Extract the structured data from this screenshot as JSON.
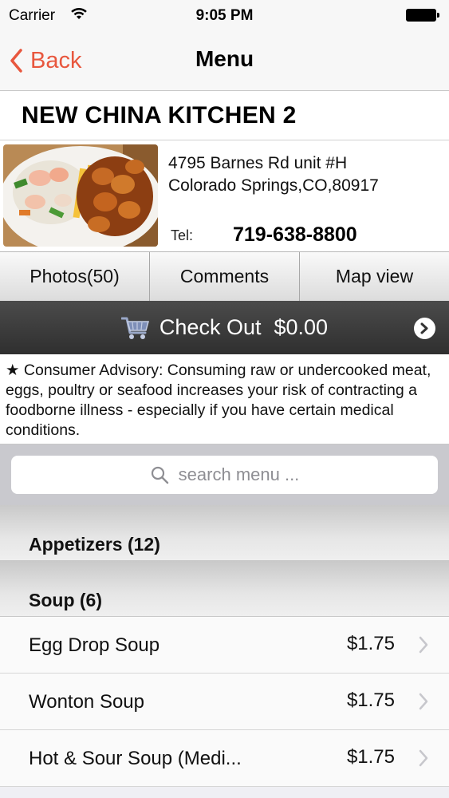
{
  "status_bar": {
    "carrier": "Carrier",
    "time": "9:05 PM"
  },
  "nav": {
    "back_label": "Back",
    "title": "Menu"
  },
  "restaurant": {
    "name": "NEW CHINA KITCHEN 2",
    "address_line1": "4795 Barnes Rd unit #H",
    "address_line2": "Colorado Springs,CO,80917",
    "tel_label": "Tel:",
    "tel_number": "719-638-8800"
  },
  "segments": [
    "Photos(50)",
    "Comments",
    "Map view"
  ],
  "checkout": {
    "label": "Check Out",
    "total": "$0.00"
  },
  "advisory": "★ Consumer Advisory: Consuming raw or undercooked meat, eggs, poultry or seafood increases your risk of contracting a foodborne illness - especially if you have certain medical conditions.",
  "search": {
    "placeholder": "search menu ..."
  },
  "sections": [
    {
      "label": "Appetizers (12)"
    },
    {
      "label": "Soup (6)"
    }
  ],
  "items": [
    {
      "name": "Egg Drop Soup",
      "price": "$1.75"
    },
    {
      "name": "Wonton Soup",
      "price": "$1.75"
    },
    {
      "name": "Hot & Sour Soup (Medi...",
      "price": "$1.75"
    }
  ],
  "colors": {
    "accent": "#e8573e",
    "checkout_bg": "#3a3a3a"
  },
  "icons": [
    "wifi-icon",
    "battery-icon",
    "back-chevron-icon",
    "cart-icon",
    "arrow-right-circle-icon",
    "search-icon",
    "chevron-right-icon"
  ]
}
